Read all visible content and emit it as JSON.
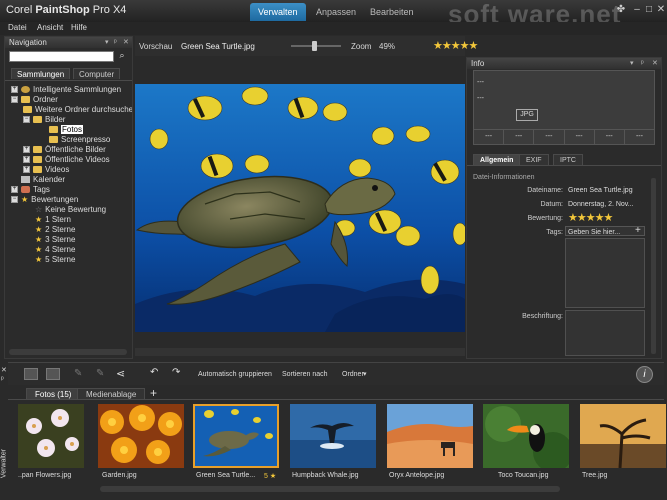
{
  "app": {
    "title_prefix": "Corel ",
    "title_bold": "PaintShop",
    "title_suffix": " Pro X4"
  },
  "tabs": [
    {
      "label": "Verwalten",
      "active": true
    },
    {
      "label": "Anpassen"
    },
    {
      "label": "Bearbeiten"
    }
  ],
  "watermark": "soft ware.net",
  "menu": [
    "Datei",
    "Ansicht",
    "Hilfe"
  ],
  "navigation": {
    "title": "Navigation",
    "tabs": [
      "Sammlungen",
      "Computer"
    ],
    "tree": [
      {
        "label": "Intelligente Sammlungen"
      },
      {
        "label": "Ordner"
      },
      {
        "label": "Weitere Ordner durchsuchen"
      },
      {
        "label": "Bilder"
      },
      {
        "label": "Fotos"
      },
      {
        "label": "Screenpresso"
      },
      {
        "label": "Öffentliche Bilder"
      },
      {
        "label": "Öffentliche Videos"
      },
      {
        "label": "Videos"
      },
      {
        "label": "Kalender"
      },
      {
        "label": "Tags"
      },
      {
        "label": "Bewertungen"
      },
      {
        "label": "Keine Bewertung"
      },
      {
        "label": "1 Stern"
      },
      {
        "label": "2 Sterne"
      },
      {
        "label": "3 Sterne"
      },
      {
        "label": "4 Sterne"
      },
      {
        "label": "5 Sterne"
      }
    ]
  },
  "preview": {
    "label": "Vorschau",
    "filename": "Green Sea Turtle.jpg",
    "zoom_label": "Zoom",
    "zoom_value": "49%",
    "rating": 5
  },
  "info": {
    "title": "Info",
    "format": "JPG",
    "histo_dash1": "---",
    "histo_dash2": "---",
    "histo_cells": [
      "---",
      "---",
      "---",
      "---",
      "---",
      "---"
    ],
    "tabs": [
      "Allgemein",
      "EXIF",
      "IPTC"
    ],
    "section": "Datei-Informationen",
    "dateiname_label": "Dateiname:",
    "dateiname": "Green Sea Turtle.jpg",
    "datum_label": "Datum:",
    "datum": "Donnerstag, 2. Nov...",
    "bewertung_label": "Bewertung:",
    "tags_label": "Tags:",
    "tags_placeholder": "Geben Sie hier...",
    "beschriftung_label": "Beschriftung:"
  },
  "organizer": {
    "vertical_label": "Verwalter",
    "toolbar": {
      "group": "Automatisch gruppieren",
      "sort": "Sortieren nach",
      "folder": "Ordner"
    },
    "tabs": [
      "Fotos (15)",
      "Medienablage"
    ],
    "add_tab": "+",
    "thumbs": [
      {
        "label": "..pan Flowers.jpg"
      },
      {
        "label": "Garden.jpg"
      },
      {
        "label": "Green Sea Turtle..."
      },
      {
        "label": "Humpback Whale.jpg"
      },
      {
        "label": "Oryx Antelope.jpg"
      },
      {
        "label": "Toco Toucan.jpg"
      },
      {
        "label": "Tree.jpg"
      }
    ],
    "rating_badge": "5 ★"
  },
  "colors": {
    "accent": "#2d82bd",
    "star": "#f3c73a",
    "selection": "#e8a02a"
  }
}
